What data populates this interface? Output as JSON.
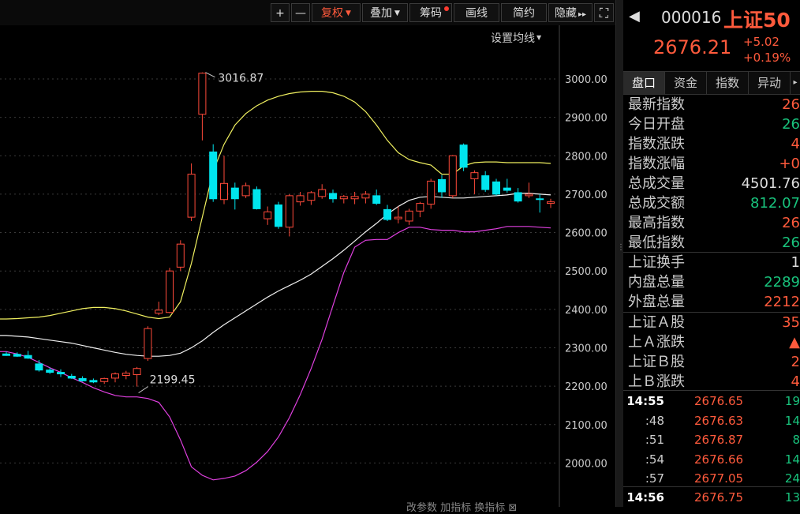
{
  "toolbar": {
    "zoom_in": "+",
    "zoom_out": "—",
    "buttons": [
      {
        "label": "复权",
        "dropdown": true
      },
      {
        "label": "叠加",
        "dropdown": true
      },
      {
        "label": "筹码",
        "dot": true
      },
      {
        "label": "画线"
      },
      {
        "label": "简约"
      },
      {
        "label": "隐藏"
      }
    ],
    "hide_arrows": "▸▸",
    "fullscreen": "⛶",
    "ma_setting": "设置均线"
  },
  "chart_data": {
    "type": "candlestick",
    "y_ticks": [
      "3000.00",
      "2900.00",
      "2800.00",
      "2700.00",
      "2600.00",
      "2500.00",
      "2400.00",
      "2300.00",
      "2200.00",
      "2100.00",
      "2000.00"
    ],
    "ylim": [
      1950,
      3060
    ],
    "high_label": "3016.87",
    "low_label": "2199.45",
    "candles": [
      {
        "o": 2284,
        "h": 2290,
        "l": 2279,
        "c": 2280
      },
      {
        "o": 2283,
        "h": 2288,
        "l": 2276,
        "c": 2278
      },
      {
        "o": 2280,
        "h": 2292,
        "l": 2271,
        "c": 2273
      },
      {
        "o": 2258,
        "h": 2268,
        "l": 2238,
        "c": 2242
      },
      {
        "o": 2242,
        "h": 2248,
        "l": 2232,
        "c": 2236
      },
      {
        "o": 2236,
        "h": 2244,
        "l": 2224,
        "c": 2232
      },
      {
        "o": 2226,
        "h": 2232,
        "l": 2219,
        "c": 2221
      },
      {
        "o": 2220,
        "h": 2226,
        "l": 2212,
        "c": 2214
      },
      {
        "o": 2215,
        "h": 2220,
        "l": 2208,
        "c": 2211
      },
      {
        "o": 2212,
        "h": 2222,
        "l": 2206,
        "c": 2220
      },
      {
        "o": 2221,
        "h": 2236,
        "l": 2210,
        "c": 2232
      },
      {
        "o": 2228,
        "h": 2240,
        "l": 2218,
        "c": 2234
      },
      {
        "o": 2230,
        "h": 2250,
        "l": 2199,
        "c": 2246
      },
      {
        "o": 2272,
        "h": 2356,
        "l": 2266,
        "c": 2350
      },
      {
        "o": 2390,
        "h": 2420,
        "l": 2385,
        "c": 2398
      },
      {
        "o": 2392,
        "h": 2508,
        "l": 2390,
        "c": 2500
      },
      {
        "o": 2510,
        "h": 2580,
        "l": 2500,
        "c": 2570
      },
      {
        "o": 2640,
        "h": 2780,
        "l": 2630,
        "c": 2752
      },
      {
        "o": 2908,
        "h": 3017,
        "l": 2840,
        "c": 3015
      },
      {
        "o": 2810,
        "h": 2830,
        "l": 2680,
        "c": 2688
      },
      {
        "o": 2686,
        "h": 2800,
        "l": 2674,
        "c": 2728
      },
      {
        "o": 2716,
        "h": 2730,
        "l": 2660,
        "c": 2688
      },
      {
        "o": 2696,
        "h": 2730,
        "l": 2690,
        "c": 2722
      },
      {
        "o": 2712,
        "h": 2720,
        "l": 2660,
        "c": 2662
      },
      {
        "o": 2636,
        "h": 2668,
        "l": 2620,
        "c": 2654
      },
      {
        "o": 2672,
        "h": 2680,
        "l": 2610,
        "c": 2616
      },
      {
        "o": 2614,
        "h": 2700,
        "l": 2590,
        "c": 2696
      },
      {
        "o": 2680,
        "h": 2706,
        "l": 2670,
        "c": 2696
      },
      {
        "o": 2684,
        "h": 2708,
        "l": 2672,
        "c": 2704
      },
      {
        "o": 2694,
        "h": 2726,
        "l": 2688,
        "c": 2712
      },
      {
        "o": 2702,
        "h": 2712,
        "l": 2678,
        "c": 2688
      },
      {
        "o": 2688,
        "h": 2698,
        "l": 2676,
        "c": 2694
      },
      {
        "o": 2688,
        "h": 2706,
        "l": 2674,
        "c": 2694
      },
      {
        "o": 2690,
        "h": 2708,
        "l": 2676,
        "c": 2700
      },
      {
        "o": 2696,
        "h": 2712,
        "l": 2672,
        "c": 2676
      },
      {
        "o": 2660,
        "h": 2672,
        "l": 2630,
        "c": 2634
      },
      {
        "o": 2636,
        "h": 2668,
        "l": 2624,
        "c": 2640
      },
      {
        "o": 2630,
        "h": 2662,
        "l": 2620,
        "c": 2656
      },
      {
        "o": 2656,
        "h": 2680,
        "l": 2640,
        "c": 2676
      },
      {
        "o": 2674,
        "h": 2740,
        "l": 2662,
        "c": 2734
      },
      {
        "o": 2738,
        "h": 2750,
        "l": 2690,
        "c": 2706
      },
      {
        "o": 2696,
        "h": 2802,
        "l": 2690,
        "c": 2800
      },
      {
        "o": 2828,
        "h": 2832,
        "l": 2760,
        "c": 2770
      },
      {
        "o": 2740,
        "h": 2762,
        "l": 2700,
        "c": 2756
      },
      {
        "o": 2748,
        "h": 2760,
        "l": 2706,
        "c": 2712
      },
      {
        "o": 2732,
        "h": 2740,
        "l": 2696,
        "c": 2700
      },
      {
        "o": 2716,
        "h": 2740,
        "l": 2704,
        "c": 2710
      },
      {
        "o": 2704,
        "h": 2716,
        "l": 2678,
        "c": 2682
      },
      {
        "o": 2696,
        "h": 2730,
        "l": 2690,
        "c": 2700
      },
      {
        "o": 2688,
        "h": 2700,
        "l": 2652,
        "c": 2686
      },
      {
        "o": 2676,
        "h": 2688,
        "l": 2664,
        "c": 2680
      }
    ],
    "series": [
      {
        "name": "upper",
        "color": "#f0f060",
        "values": [
          2375,
          2376,
          2378,
          2380,
          2384,
          2390,
          2396,
          2402,
          2405,
          2405,
          2402,
          2396,
          2388,
          2380,
          2376,
          2380,
          2420,
          2520,
          2640,
          2760,
          2830,
          2880,
          2910,
          2930,
          2945,
          2955,
          2962,
          2966,
          2968,
          2968,
          2964,
          2955,
          2940,
          2915,
          2880,
          2840,
          2808,
          2790,
          2782,
          2776,
          2752,
          2752,
          2774,
          2782,
          2784,
          2784,
          2782,
          2782,
          2782,
          2782,
          2780
        ]
      },
      {
        "name": "mid",
        "color": "#f0f0f0",
        "values": [
          2332,
          2330,
          2328,
          2324,
          2320,
          2316,
          2312,
          2306,
          2300,
          2294,
          2288,
          2283,
          2280,
          2278,
          2278,
          2280,
          2286,
          2300,
          2318,
          2340,
          2360,
          2378,
          2396,
          2414,
          2432,
          2448,
          2462,
          2476,
          2492,
          2512,
          2532,
          2554,
          2578,
          2602,
          2624,
          2648,
          2668,
          2684,
          2692,
          2694,
          2692,
          2690,
          2690,
          2692,
          2694,
          2696,
          2698,
          2702,
          2702,
          2700,
          2698
        ]
      },
      {
        "name": "lower",
        "color": "#e040e0",
        "values": [
          2290,
          2284,
          2275,
          2262,
          2248,
          2236,
          2222,
          2210,
          2196,
          2185,
          2176,
          2172,
          2172,
          2168,
          2158,
          2120,
          2060,
          1990,
          1968,
          1956,
          1960,
          1966,
          1980,
          2002,
          2030,
          2068,
          2118,
          2178,
          2246,
          2322,
          2410,
          2496,
          2562,
          2580,
          2582,
          2582,
          2600,
          2614,
          2614,
          2608,
          2606,
          2606,
          2602,
          2602,
          2606,
          2610,
          2616,
          2616,
          2616,
          2614,
          2612
        ]
      }
    ]
  },
  "panel": {
    "back": "◀",
    "code": "000016",
    "name": "上证50",
    "price": "2676.21",
    "change": "+5.02",
    "change_pct": "+0.19%",
    "tabs": [
      "盘口",
      "资金",
      "指数",
      "异动"
    ],
    "tab_more": "▸",
    "stats": [
      {
        "label": "最新指数",
        "value": "26",
        "color": "red"
      },
      {
        "label": "今日开盘",
        "value": "26",
        "color": "green"
      },
      {
        "label": "指数涨跌",
        "value": "4",
        "color": "red"
      },
      {
        "label": "指数涨幅",
        "value": "+0",
        "color": "red"
      },
      {
        "label": "总成交量",
        "value": "4501.76",
        "color": "white"
      },
      {
        "label": "总成交额",
        "value": "812.07",
        "color": "green"
      },
      {
        "label": "最高指数",
        "value": "26",
        "color": "red"
      },
      {
        "label": "最低指数",
        "value": "26",
        "color": "green"
      }
    ],
    "stats2": [
      {
        "label": "上证换手",
        "value": "1",
        "color": "white"
      },
      {
        "label": "内盘总量",
        "value": "2289",
        "color": "green"
      },
      {
        "label": "外盘总量",
        "value": "2212",
        "color": "red"
      }
    ],
    "stats3": [
      {
        "label": "上证Ａ股",
        "value": "35",
        "color": "red"
      },
      {
        "label": "上Ａ涨跌",
        "value": "▲",
        "color": "red"
      },
      {
        "label": "上证Ｂ股",
        "value": "2",
        "color": "red"
      },
      {
        "label": "上Ｂ涨跌",
        "value": "4",
        "color": "red"
      }
    ],
    "ticks": [
      {
        "time": "14:55",
        "price": "2676.65",
        "vol": "19"
      },
      {
        "time": ":48",
        "price": "2676.63",
        "vol": "14"
      },
      {
        "time": ":51",
        "price": "2676.87",
        "vol": "8"
      },
      {
        "time": ":54",
        "price": "2676.66",
        "vol": "14"
      },
      {
        "time": ":57",
        "price": "2677.05",
        "vol": "24"
      },
      {
        "time": "14:56",
        "price": "2676.75",
        "vol": "13"
      }
    ]
  },
  "bottom_tabs": "改参数  加指标  换指标  ⊠"
}
